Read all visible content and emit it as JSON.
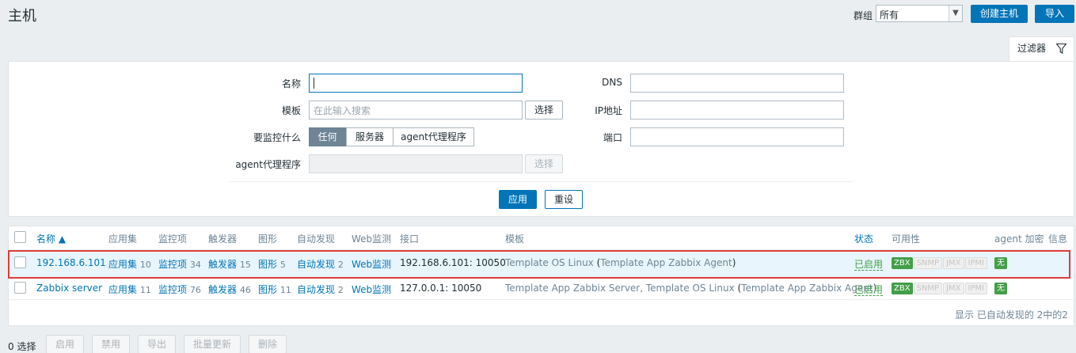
{
  "header": {
    "title": "主机",
    "group_label": "群组",
    "group_value": "所有",
    "create_button": "创建主机",
    "import_button": "导入"
  },
  "filter": {
    "tab_label": "过滤器",
    "name_label": "名称",
    "name_value": "",
    "template_label": "模板",
    "template_placeholder": "在此输入搜索",
    "select_button": "选择",
    "monitored_by_label": "要监控什么",
    "monitored_by_options": [
      "任何",
      "服务器",
      "agent代理程序"
    ],
    "monitored_by_selected": "任何",
    "proxy_label": "agent代理程序",
    "proxy_select_button": "选择",
    "dns_label": "DNS",
    "ip_label": "IP地址",
    "port_label": "端口",
    "apply_button": "应用",
    "reset_button": "重设"
  },
  "table": {
    "columns": {
      "name": "名称 ▲",
      "applications": "应用集",
      "items": "监控项",
      "triggers": "触发器",
      "graphs": "图形",
      "discovery": "自动发现",
      "web": "Web监测",
      "interface": "接口",
      "templates": "模板",
      "status": "状态",
      "availability": "可用性",
      "encryption": "agent 加密",
      "info": "信息"
    },
    "rows": [
      {
        "name": "192.168.6.101",
        "applications": "应用集",
        "applications_count": "10",
        "items": "监控项",
        "items_count": "34",
        "triggers": "触发器",
        "triggers_count": "15",
        "graphs": "图形",
        "graphs_count": "5",
        "discovery": "自动发现",
        "discovery_count": "2",
        "web": "Web监测",
        "interface": "192.168.6.101: 10050",
        "template_main": "Template OS Linux",
        "template_paren_open": " (",
        "template_sub": "Template App Zabbix Agent",
        "template_paren_close": ")",
        "status": "已启用",
        "availability": [
          "ZBX",
          "SNMP",
          "JMX",
          "IPMI"
        ],
        "encryption": "无"
      },
      {
        "name": "Zabbix server",
        "applications": "应用集",
        "applications_count": "11",
        "items": "监控项",
        "items_count": "76",
        "triggers": "触发器",
        "triggers_count": "46",
        "graphs": "图形",
        "graphs_count": "11",
        "discovery": "自动发现",
        "discovery_count": "2",
        "web": "Web监测",
        "interface": "127.0.0.1: 10050",
        "template_main": "Template App Zabbix Server, Template OS Linux",
        "template_paren_open": " (",
        "template_sub": "Template App Zabbix Agent",
        "template_paren_close": ")",
        "status": "已启用",
        "availability": [
          "ZBX",
          "SNMP",
          "JMX",
          "IPMI"
        ],
        "encryption": "无"
      }
    ],
    "footer": "显示 已自动发现的 2中的2"
  },
  "mass_actions": {
    "selected": "0 选择",
    "enable": "启用",
    "disable": "禁用",
    "export": "导出",
    "mass_update": "批量更新",
    "delete": "删除"
  },
  "colors": {
    "accent": "#0275b8",
    "enabled": "#429e47",
    "highlight_border": "#e03c3c"
  }
}
